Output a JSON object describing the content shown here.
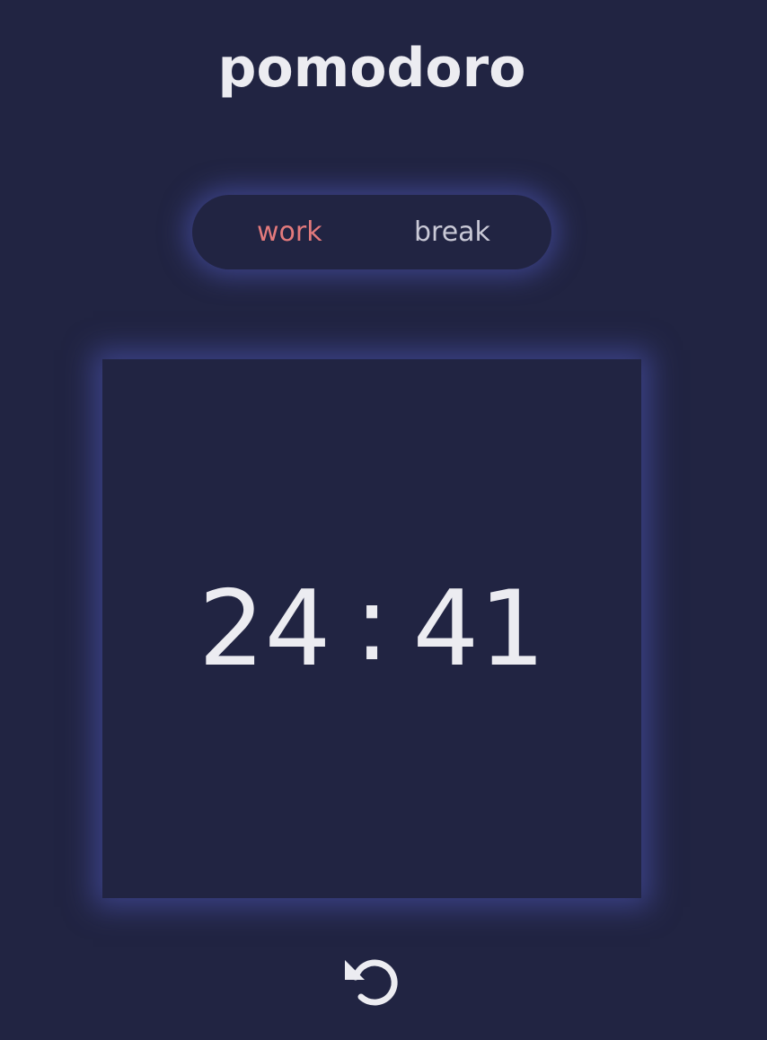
{
  "app": {
    "title": "pomodoro"
  },
  "modes": [
    {
      "label": "work",
      "active": true
    },
    {
      "label": "break",
      "active": false
    }
  ],
  "timer": {
    "minutes": "24",
    "separator": ":",
    "seconds": "41"
  },
  "controls": {
    "reset_icon": "reset-icon"
  },
  "colors": {
    "background": "#212442",
    "active_mode": "#e37a7c",
    "inactive_mode": "#c9c9d6",
    "text": "#ececf1",
    "glow": "#505abe"
  }
}
